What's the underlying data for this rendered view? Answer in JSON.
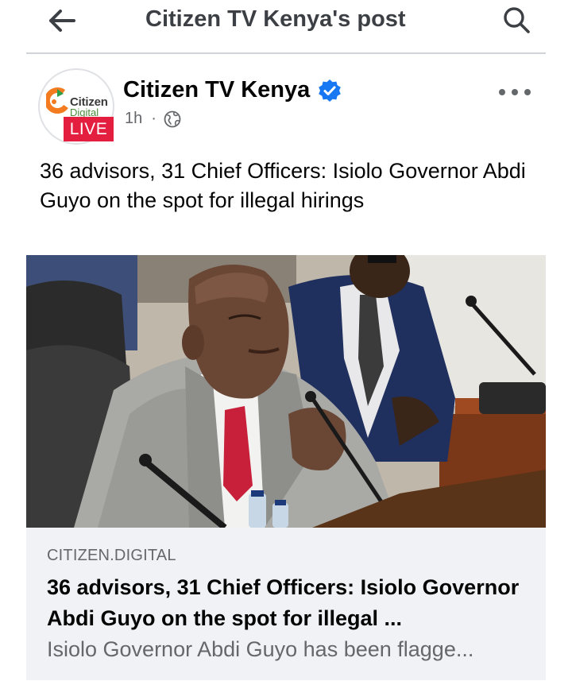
{
  "topbar": {
    "title": "Citizen TV Kenya's post"
  },
  "post": {
    "avatar": {
      "brand_line1": "Citizen",
      "brand_line2": "Digital",
      "live_label": "LIVE"
    },
    "page_name": "Citizen TV Kenya",
    "time": "1h",
    "meta_separator": "·",
    "text": "36 advisors, 31 Chief Officers: Isiolo Governor Abdi Guyo on the spot for illegal hirings"
  },
  "link_card": {
    "domain": "CITIZEN.DIGITAL",
    "title": "36 advisors, 31 Chief Officers: Isiolo Governor Abdi Guyo on the spot for illegal ...",
    "description": "Isiolo Governor Abdi Guyo has been flagge..."
  },
  "colors": {
    "verified": "#1877f2",
    "live_badge": "#e41e3f",
    "secondary_text": "#65676b",
    "card_background": "#f0f2f5"
  },
  "icons": {
    "back": "arrow-left-icon",
    "search": "search-icon",
    "verified": "verified-badge-icon",
    "privacy": "globe-icon",
    "more": "more-dots-icon"
  }
}
